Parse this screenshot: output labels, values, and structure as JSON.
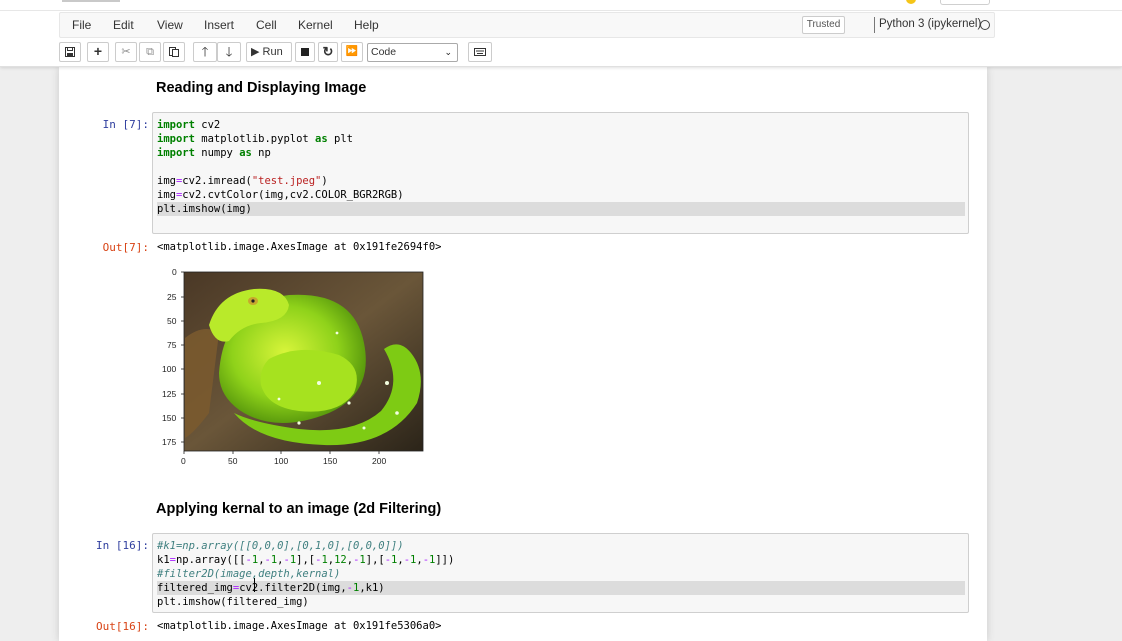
{
  "menubar": {
    "items": [
      "File",
      "Edit",
      "View",
      "Insert",
      "Cell",
      "Kernel",
      "Help"
    ],
    "trusted": "Trusted",
    "kernel": "Python 3 (ipykernel)"
  },
  "toolbar": {
    "run_label": "Run",
    "cell_type": "Code",
    "icons": [
      "save-icon",
      "add-cell-icon",
      "cut-icon",
      "copy-icon",
      "paste-icon",
      "move-up-icon",
      "move-down-icon",
      "run-icon",
      "interrupt-icon",
      "restart-icon",
      "fast-forward-icon",
      "keyboard-icon"
    ]
  },
  "cells": {
    "heading1": "Reading and Displaying Image",
    "cell1": {
      "prompt_in": "In [7]:",
      "prompt_out": "Out[7]:",
      "output": "<matplotlib.image.AxesImage at 0x191fe2694f0>"
    },
    "heading2": "Applying kernal to an image (2d Filtering)",
    "cell2": {
      "prompt_in": "In [16]:",
      "prompt_out": "Out[16]:",
      "output": "<matplotlib.image.AxesImage at 0x191fe5306a0>"
    }
  },
  "plot": {
    "image_description": "green snake",
    "y_ticks": [
      "0",
      "25",
      "50",
      "75",
      "100",
      "125",
      "150",
      "175"
    ],
    "x_ticks": [
      "0",
      "50",
      "100",
      "150",
      "200"
    ]
  }
}
